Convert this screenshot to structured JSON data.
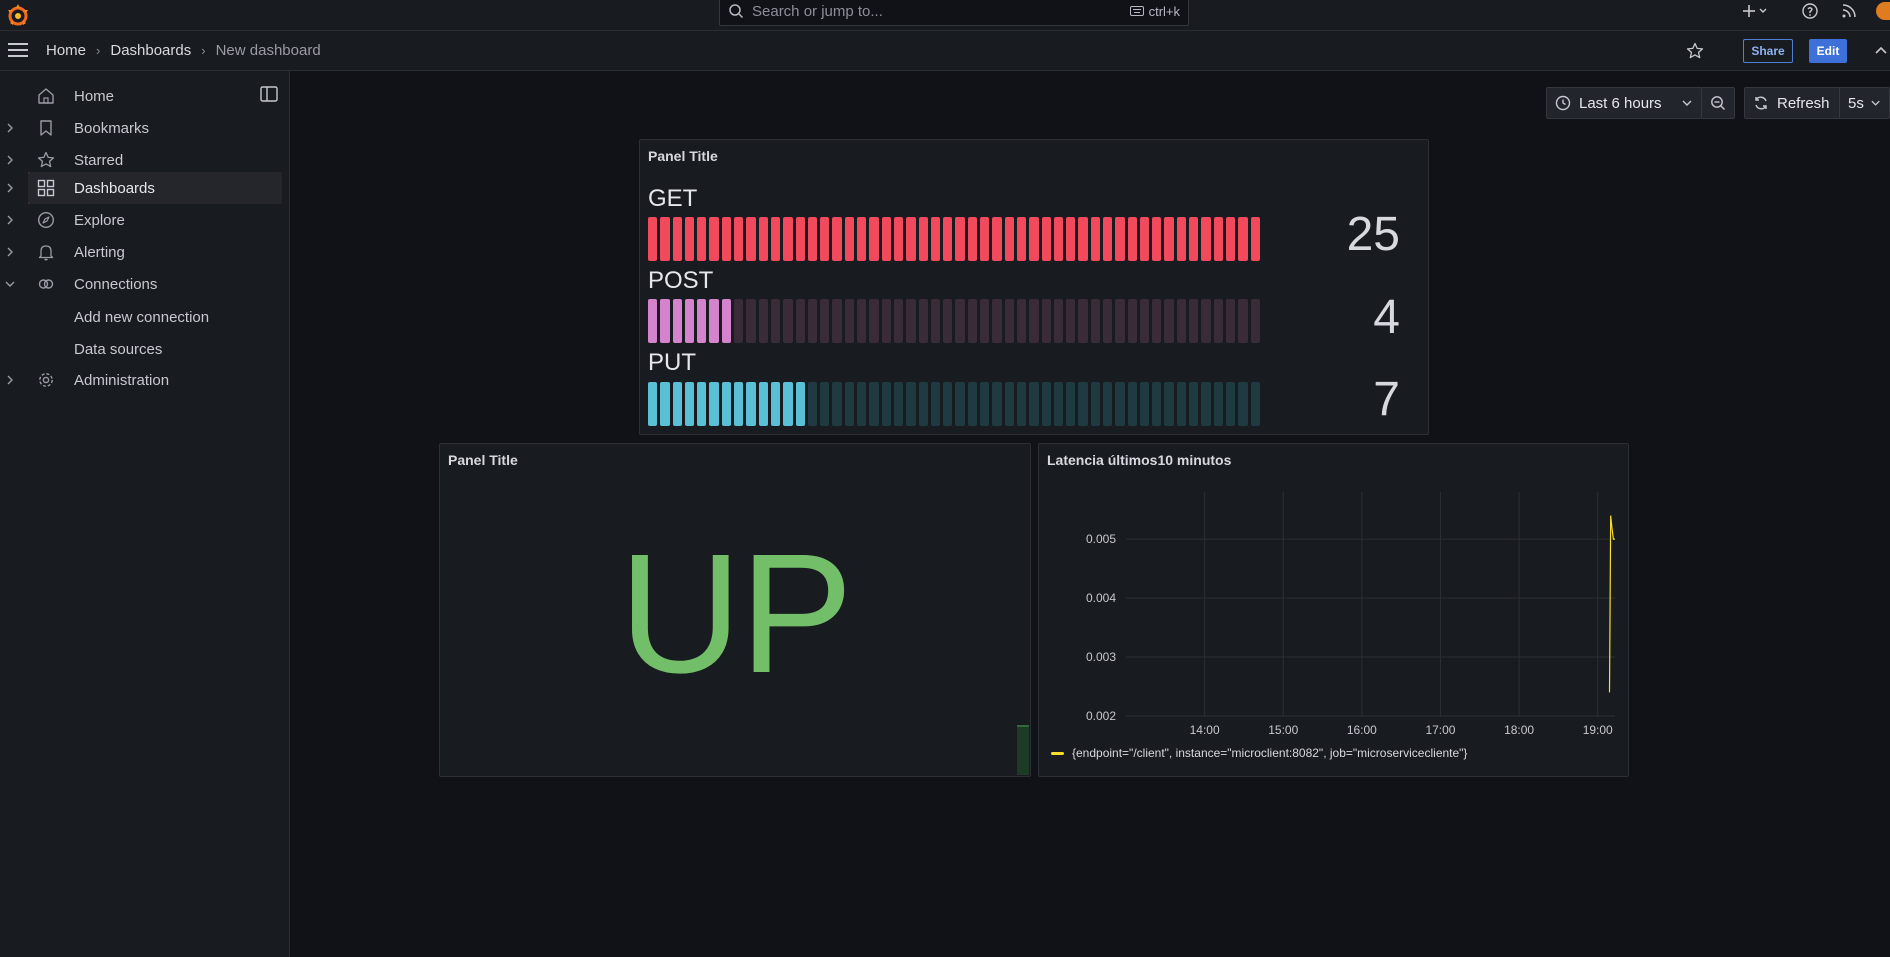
{
  "topbar": {
    "search_placeholder": "Search or jump to...",
    "search_shortcut": "ctrl+k",
    "icons": [
      "grafana-logo-icon",
      "search-icon",
      "keyboard-icon",
      "plus-icon",
      "help-icon",
      "news-icon",
      "user-avatar"
    ]
  },
  "breadcrumb": [
    "Home",
    "Dashboards",
    "New dashboard"
  ],
  "actions": {
    "share": "Share",
    "edit": "Edit"
  },
  "sidebar": {
    "items": [
      {
        "label": "Home",
        "icon": "home-icon",
        "expandable": false
      },
      {
        "label": "Bookmarks",
        "icon": "bookmark-icon",
        "expandable": true
      },
      {
        "label": "Starred",
        "icon": "star-icon",
        "expandable": true
      },
      {
        "label": "Dashboards",
        "icon": "apps-icon",
        "expandable": true,
        "active": true
      },
      {
        "label": "Explore",
        "icon": "compass-icon",
        "expandable": true
      },
      {
        "label": "Alerting",
        "icon": "bell-icon",
        "expandable": true
      },
      {
        "label": "Connections",
        "icon": "link-icon",
        "expandable": true,
        "expanded": true
      },
      {
        "label": "Administration",
        "icon": "cog-icon",
        "expandable": true
      }
    ],
    "sub_items": [
      "Add new connection",
      "Data sources"
    ]
  },
  "controls": {
    "time_range": "Last 6 hours",
    "refresh": "Refresh",
    "interval": "5s"
  },
  "colors": {
    "accent": "#ff7a2b",
    "get": "#f2495c",
    "post": "#d683ce",
    "put": "#5ac0d6",
    "up": "#73bf69",
    "series": "#fade2a",
    "primary_button": "#3d71d9"
  },
  "bar_gauge": {
    "title": "Panel Title",
    "cells": 50,
    "rows": [
      {
        "label": "GET",
        "value": "25",
        "fill_fraction": 1.0,
        "color": "#f2495c",
        "dim": "#3a2a32"
      },
      {
        "label": "POST",
        "value": "4",
        "fill_fraction": 0.14,
        "color": "#d683ce",
        "dim": "#3a2b38"
      },
      {
        "label": "PUT",
        "value": "7",
        "fill_fraction": 0.26,
        "color": "#5ac0d6",
        "dim": "#1f3a41"
      }
    ]
  },
  "stat": {
    "title": "Panel Title",
    "value": "UP"
  },
  "chart_data": {
    "type": "line",
    "title": "Latencia últimos10 minutos",
    "x_ticks": [
      "14:00",
      "15:00",
      "16:00",
      "17:00",
      "18:00",
      "19:00"
    ],
    "y_ticks": [
      "0.002",
      "0.003",
      "0.004",
      "0.005"
    ],
    "ylim": [
      0.002,
      0.0058
    ],
    "xlim_hours": [
      13.0,
      19.22
    ],
    "grid": true,
    "legend_position": "bottom",
    "series": [
      {
        "name": "{endpoint=\"/client\", instance=\"microclient:8082\", job=\"microservicecliente\"}",
        "x_hours": [
          19.15,
          19.165,
          19.18,
          19.2,
          19.22
        ],
        "values": [
          0.0024,
          0.0054,
          0.0052,
          0.005,
          0.005
        ]
      }
    ]
  }
}
